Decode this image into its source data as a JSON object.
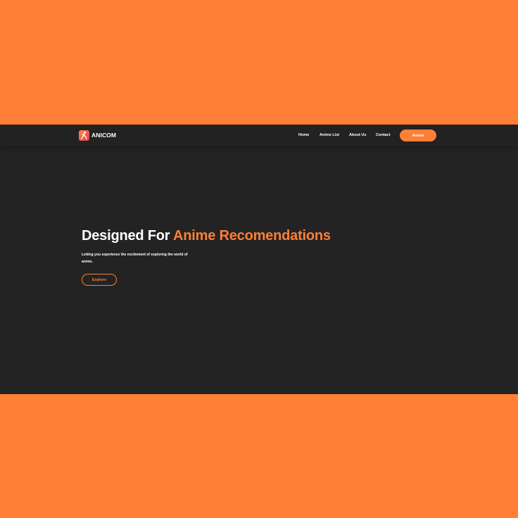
{
  "brand": {
    "name": "ANICOM",
    "logo_icon": "anime-figure-icon",
    "logo_gradient": [
      "#ff8a3c",
      "#e8364e"
    ]
  },
  "nav": {
    "links": [
      "Home",
      "Anime List",
      "About Us",
      "Contact"
    ],
    "cta_label": "Anime"
  },
  "hero": {
    "title_lead": "Designed For ",
    "title_accent": "Anime Recomendations",
    "description": "Letting you experience the excitement of exploring the world of anime.",
    "button_label": "Explore"
  },
  "colors": {
    "accent": "#ff7f36",
    "background_outer": "#ff7f36",
    "background_page": "#232323",
    "navbar": "#222222",
    "text": "#ffffff"
  }
}
